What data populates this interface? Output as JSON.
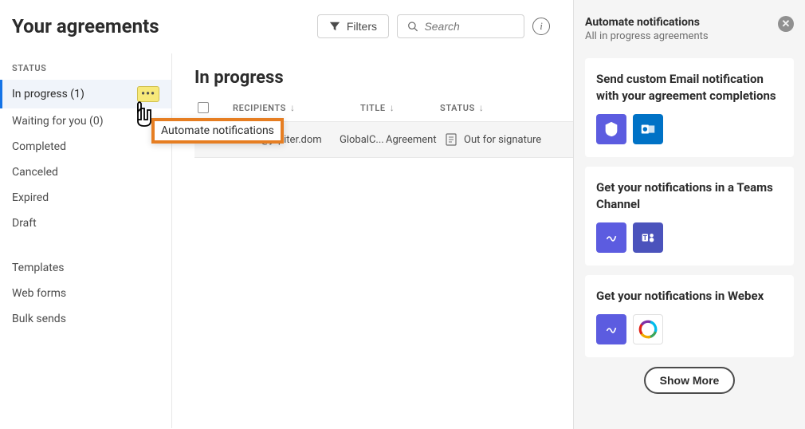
{
  "header": {
    "title": "Your agreements",
    "filters_label": "Filters",
    "search_placeholder": "Search"
  },
  "sidebar": {
    "heading": "STATUS",
    "items": [
      {
        "label": "In progress (1)",
        "active": true
      },
      {
        "label": "Waiting for you (0)"
      },
      {
        "label": "Completed"
      },
      {
        "label": "Canceled"
      },
      {
        "label": "Expired"
      },
      {
        "label": "Draft"
      }
    ],
    "group2": [
      {
        "label": "Templates"
      },
      {
        "label": "Web forms"
      },
      {
        "label": "Bulk sends"
      }
    ]
  },
  "popup": {
    "label": "Automate notifications"
  },
  "content": {
    "title": "In progress",
    "columns": {
      "recipients": "RECIPIENTS",
      "title": "TITLE",
      "status": "STATUS"
    },
    "row": {
      "recipient": "e@jupiter.dom",
      "title": "GlobalC...",
      "type": "Agreement",
      "status": "Out for signature"
    }
  },
  "panel": {
    "title": "Automate notifications",
    "subtitle": "All in progress agreements",
    "cards": [
      {
        "title": "Send custom Email notification with your agreement completions"
      },
      {
        "title": "Get your notifications in a Teams Channel"
      },
      {
        "title": "Get your notifications in Webex"
      }
    ],
    "show_more": "Show More"
  }
}
